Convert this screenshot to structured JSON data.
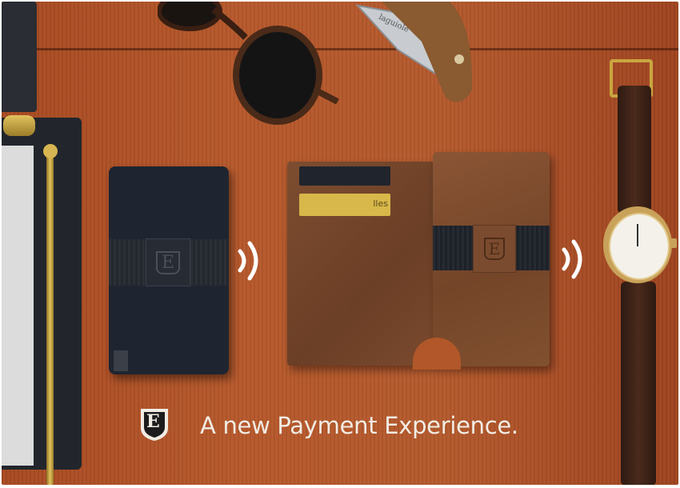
{
  "tagline": "A new Payment Experience.",
  "logo": {
    "letter": "E"
  },
  "card_text": "lles",
  "knife_text": "laguiole",
  "colors": {
    "wood": "#b5582b",
    "wallet_black": "#1f2530",
    "wallet_brown": "#7a4a2e",
    "text": "#f1ece4",
    "gold": "#c9a640"
  },
  "icons": [
    "logo-shield-icon",
    "wireless-signal-icon",
    "wireless-signal-icon"
  ]
}
